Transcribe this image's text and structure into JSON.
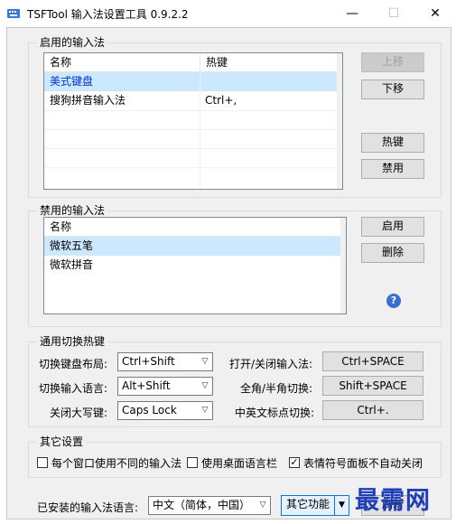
{
  "window": {
    "title": "TSFTool 输入法设置工具 0.9.2.2",
    "min_label": "—",
    "max_label": "☐",
    "close_label": "✕"
  },
  "enabled_group": {
    "title": "启用的输入法",
    "columns": [
      "名称",
      "热键"
    ],
    "rows": [
      {
        "name": "美式键盘",
        "hotkey": ""
      },
      {
        "name": "搜狗拼音输入法",
        "hotkey": "Ctrl+,"
      }
    ],
    "buttons": {
      "up": "上移",
      "down": "下移",
      "hotkey": "热键",
      "disable": "禁用"
    }
  },
  "disabled_group": {
    "title": "禁用的输入法",
    "columns": [
      "名称"
    ],
    "rows": [
      "微软五笔",
      "微软拼音"
    ],
    "buttons": {
      "enable": "启用",
      "delete": "删除"
    },
    "help_label": "?"
  },
  "hotkeys_group": {
    "title": "通用切换热键",
    "left": [
      {
        "label": "切换键盘布局:",
        "value": "Ctrl+Shift"
      },
      {
        "label": "切换输入语言:",
        "value": "Alt+Shift"
      },
      {
        "label": "关闭大写键:",
        "value": "Caps Lock"
      }
    ],
    "right": [
      {
        "label": "打开/关闭输入法:",
        "value": "Ctrl+SPACE"
      },
      {
        "label": "全角/半角切换:",
        "value": "Shift+SPACE"
      },
      {
        "label": "中英文标点切换:",
        "value": "Ctrl+."
      }
    ]
  },
  "other_group": {
    "title": "其它设置",
    "options": [
      {
        "label": "每个窗口使用不同的输入法",
        "checked": false
      },
      {
        "label": "使用桌面语言栏",
        "checked": false
      },
      {
        "label": "表情符号面板不自动关闭",
        "checked": true
      }
    ]
  },
  "bottom": {
    "lang_label": "已安装的输入法语言:",
    "lang_value": "中文（简体，中国）",
    "other_func_label": "其它功能",
    "refresh_label": "刷新"
  },
  "watermark": "最需网",
  "colors": {
    "selection": "#cce8ff",
    "watermark": "#1f3fb8"
  }
}
